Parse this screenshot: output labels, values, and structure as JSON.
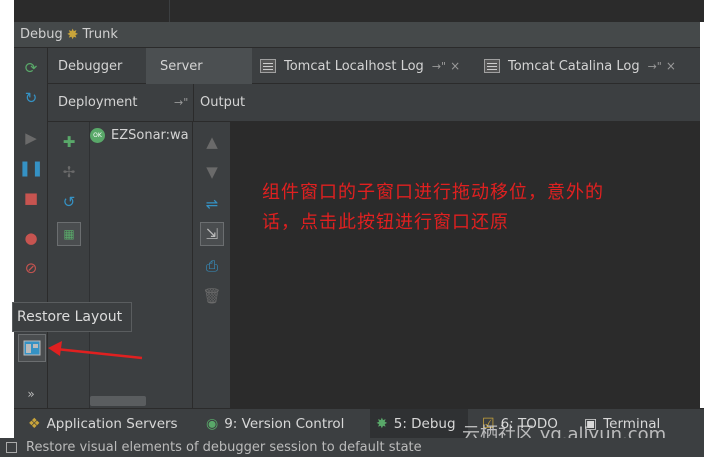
{
  "window": {
    "title_prefix": "Debug",
    "title": "Trunk"
  },
  "tabs": [
    {
      "label": "Debugger"
    },
    {
      "label": "Server"
    },
    {
      "label": "Tomcat Localhost Log",
      "pin": "→\"",
      "close": "×"
    },
    {
      "label": "Tomcat Catalina Log",
      "pin": "→\"",
      "close": "×"
    }
  ],
  "panels": {
    "deployment_title": "Deployment",
    "deployment_pin": "→\"",
    "output_title": "Output",
    "deployment_item": "EZSonar:wa",
    "ok_badge": "OK"
  },
  "annotation": {
    "line1": "组件窗口的子窗口进行拖动移位，意外的",
    "line2": "话，点击此按钮进行窗口还原"
  },
  "tooltip": "Restore Layout",
  "more": "»",
  "bottom_tabs": [
    {
      "label": "Application Servers",
      "icon": "server-icon"
    },
    {
      "label": "9: Version Control",
      "icon": "vcs-icon"
    },
    {
      "label": "5: Debug",
      "icon": "bug-icon"
    },
    {
      "label": "6: TODO",
      "icon": "todo-icon"
    },
    {
      "label": "Terminal",
      "icon": "terminal-icon"
    }
  ],
  "status": "Restore visual elements of debugger session to default state",
  "watermark": "云栖社区 yq.aliyun.com",
  "colors": {
    "accent_green": "#59a869",
    "accent_blue": "#3592c4",
    "stop_red": "#c75450",
    "annotation_red": "#e02020"
  }
}
